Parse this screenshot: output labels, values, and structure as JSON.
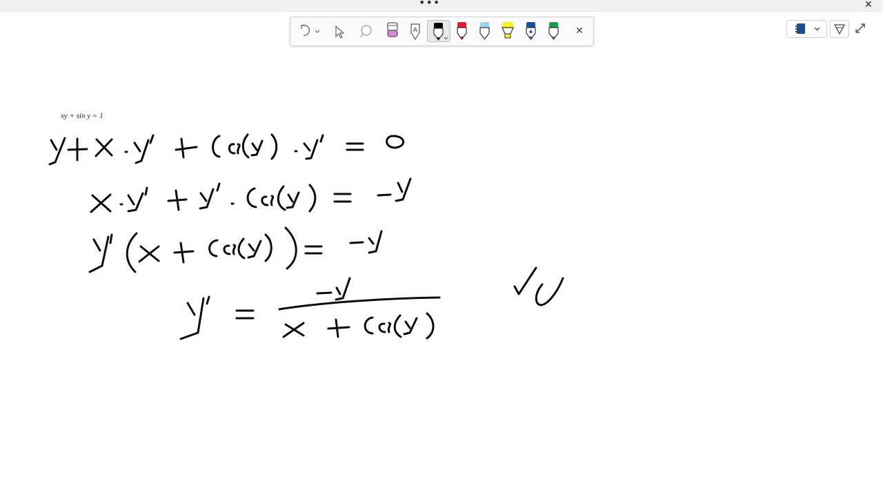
{
  "window": {
    "more_glyph": "•••",
    "close_glyph": "✕"
  },
  "toolbar": {
    "close_glyph": "✕",
    "pens": [
      {
        "icon": "pen-icon",
        "color": "#000000"
      },
      {
        "icon": "pen-icon",
        "color": "#e01a2e"
      },
      {
        "icon": "pen-icon",
        "color": "#9bd3e8"
      },
      {
        "icon": "highlighter-icon",
        "color": "#f7ee2a"
      },
      {
        "icon": "pen-icon",
        "color": "#1a4f9c"
      },
      {
        "icon": "pen-icon",
        "color": "#1f9a4a"
      }
    ]
  },
  "canvas": {
    "typed_equation": "xy + sin y = 1"
  }
}
